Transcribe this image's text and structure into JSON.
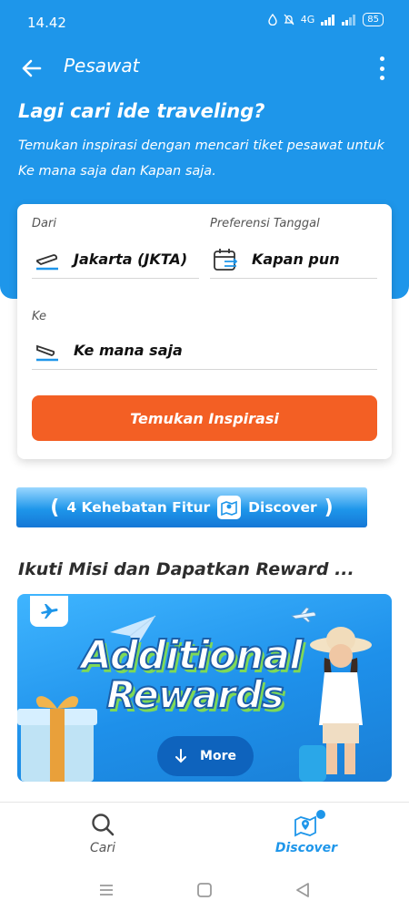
{
  "status_bar": {
    "time": "14.42",
    "network": "4G",
    "battery": "85"
  },
  "app_bar": {
    "title": "Pesawat"
  },
  "hero": {
    "title": "Lagi cari ide traveling?",
    "subtitle": "Temukan inspirasi dengan mencari tiket pesawat untuk Ke mana saja dan Kapan saja."
  },
  "search_card": {
    "from_label": "Dari",
    "from_value": "Jakarta (JKTA)",
    "date_label": "Preferensi Tanggal",
    "date_value": "Kapan pun",
    "to_label": "Ke",
    "to_value": "Ke mana saja",
    "submit_label": "Temukan Inspirasi"
  },
  "discover_banner": {
    "label": "4 Kehebatan Fitur",
    "brand": "Discover"
  },
  "missions": {
    "title": "Ikuti Misi dan Dapatkan Reward ...",
    "promo_line1": "Additional",
    "promo_line2": "Rewards",
    "more_label": "More"
  },
  "bottom_nav": {
    "items": [
      {
        "label": "Cari",
        "icon": "search-icon",
        "active": false
      },
      {
        "label": "Discover",
        "icon": "discover-map-pin-icon",
        "active": true
      }
    ]
  },
  "colors": {
    "header_blue": "#1e96ea",
    "cta_orange": "#f35f24",
    "active_nav": "#1e96ea"
  }
}
